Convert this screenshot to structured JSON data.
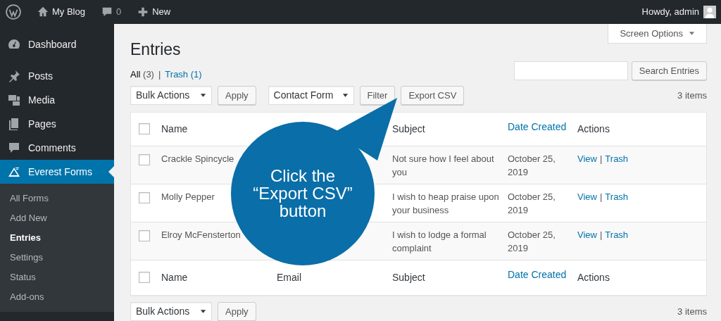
{
  "admin_bar": {
    "site": "My Blog",
    "comments": "0",
    "new": "New",
    "greeting": "Howdy, admin"
  },
  "sidebar": {
    "items": [
      {
        "label": "Dashboard",
        "selected": false
      },
      {
        "label": "Posts",
        "selected": false
      },
      {
        "label": "Media",
        "selected": false
      },
      {
        "label": "Pages",
        "selected": false
      },
      {
        "label": "Comments",
        "selected": false
      },
      {
        "label": "Everest Forms",
        "selected": true,
        "children": [
          {
            "label": "All Forms",
            "selected": false
          },
          {
            "label": "Add New",
            "selected": false
          },
          {
            "label": "Entries",
            "selected": true
          },
          {
            "label": "Settings",
            "selected": false
          },
          {
            "label": "Status",
            "selected": false
          },
          {
            "label": "Add-ons",
            "selected": false
          }
        ]
      }
    ]
  },
  "screen_options": "Screen Options",
  "title": "Entries",
  "views": {
    "separator": "|",
    "items": [
      {
        "label": "All",
        "count": "(3)",
        "selected": true
      },
      {
        "label": "Trash",
        "count": "(1)",
        "selected": false
      }
    ]
  },
  "search": {
    "button": "Search Entries"
  },
  "top_toolbar": {
    "bulk_action": "Bulk Actions",
    "apply": "Apply",
    "form_filter": "Contact Form",
    "filter": "Filter",
    "export": "Export CSV",
    "count": "3 items"
  },
  "table": {
    "header": {
      "checked": false,
      "name": {
        "label": "Name",
        "sortable": false
      },
      "subject": {
        "label": "Subject",
        "sortable": false
      },
      "date": {
        "label": "Date Created",
        "sortable": true
      },
      "actions": {
        "label": "Actions",
        "sortable": false
      }
    },
    "rows": [
      {
        "checked": false,
        "name": "Crackle Spincycle",
        "subject": "Not sure how I feel about you",
        "date": "October 25, 2019",
        "actions": [
          "View",
          "Trash"
        ],
        "separator": "|"
      },
      {
        "checked": false,
        "name": "Molly Pepper",
        "subject": "I wish to heap praise upon your business",
        "date": "October 25, 2019",
        "actions": [
          "View",
          "Trash"
        ],
        "separator": "|"
      },
      {
        "checked": false,
        "name": "Elroy McFensterton",
        "subject": "I wish to lodge a formal complaint",
        "date": "October 25, 2019",
        "actions": [
          "View",
          "Trash"
        ],
        "separator": "|"
      }
    ],
    "footer": {
      "checked": false,
      "name": {
        "label": "Name",
        "sortable": false
      },
      "email": {
        "label": "Email",
        "sortable": false
      },
      "subject": {
        "label": "Subject",
        "sortable": false
      },
      "date": {
        "label": "Date Created",
        "sortable": true
      },
      "actions": {
        "label": "Actions",
        "sortable": false
      }
    }
  },
  "bottom_toolbar": {
    "bulk_action": "Bulk Actions",
    "apply": "Apply",
    "count": "3 items"
  },
  "callout": {
    "lines": [
      "Click the",
      "“Export CSV”",
      "button"
    ]
  }
}
